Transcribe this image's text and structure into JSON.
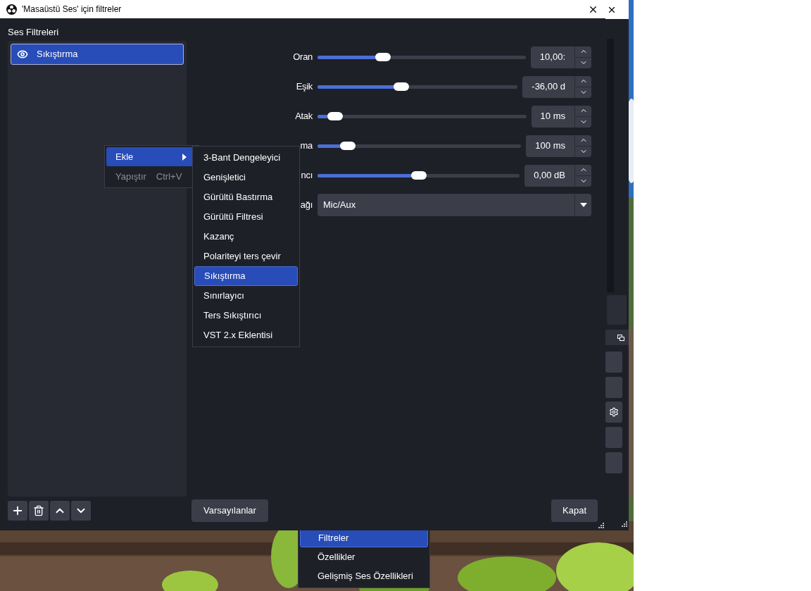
{
  "dialog": {
    "title": "'Masaüstü Ses' için filtreler",
    "section_label": "Ses Filtreleri",
    "filters": [
      {
        "name": "Sıkıştırma",
        "visible": true,
        "selected": true
      }
    ],
    "properties": [
      {
        "kind": "slider",
        "label": "Oran",
        "level": 0.3,
        "value": "10,00:"
      },
      {
        "kind": "slider",
        "label": "Eşik",
        "level": 0.41,
        "value": "-36,00 d"
      },
      {
        "kind": "slider",
        "label": "Atak",
        "level": 0.05,
        "value": "10 ms"
      },
      {
        "kind": "slider",
        "label": "ma",
        "level": 0.12,
        "value": "100 ms"
      },
      {
        "kind": "slider",
        "label": "ncı",
        "level": 0.5,
        "value": "0,00 dB"
      },
      {
        "kind": "dropdown",
        "label": "ağı",
        "value": "Mic/Aux"
      }
    ],
    "defaults_button": "Varsayılanlar",
    "close_button": "Kapat"
  },
  "context_menu": {
    "items": [
      {
        "label": "Ekle",
        "selected": true,
        "disabled": false,
        "has_submenu": true
      },
      {
        "label": "Yapıştır",
        "shortcut": "Ctrl+V",
        "selected": false,
        "disabled": true,
        "has_submenu": false
      }
    ]
  },
  "submenu": {
    "items": [
      {
        "label": "3-Bant Dengeleyici",
        "selected": false
      },
      {
        "label": "Genişletici",
        "selected": false
      },
      {
        "label": "Gürültü Bastırma",
        "selected": false
      },
      {
        "label": "Gürültü Filtresi",
        "selected": false
      },
      {
        "label": "Kazanç",
        "selected": false
      },
      {
        "label": "Polariteyi ters çevir",
        "selected": false
      },
      {
        "label": "Sıkıştırma",
        "selected": true
      },
      {
        "label": "Sınırlayıcı",
        "selected": false
      },
      {
        "label": "Ters Sıkıştırıcı",
        "selected": false
      },
      {
        "label": "VST 2.x Eklentisi",
        "selected": false
      }
    ]
  },
  "source_menu": {
    "items": [
      {
        "label": "Filtreler",
        "selected": true
      },
      {
        "label": "Özellikler",
        "selected": false
      },
      {
        "label": "Gelişmiş Ses Özellikleri",
        "selected": false
      }
    ]
  }
}
